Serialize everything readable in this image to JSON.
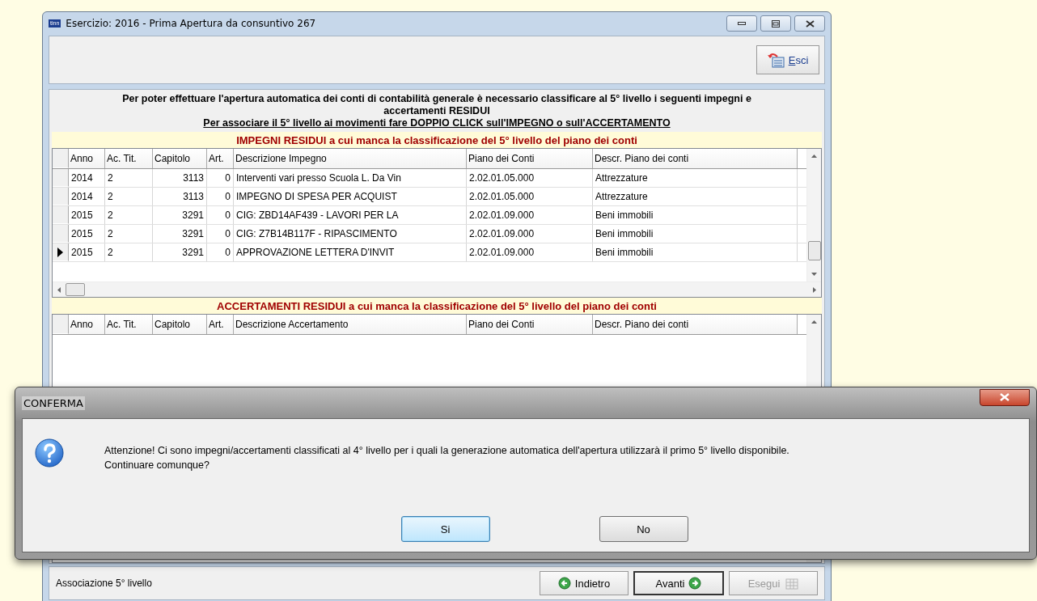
{
  "window": {
    "title": "Esercizio: 2016 - Prima Apertura da consuntivo 267",
    "app_icon": "tinn"
  },
  "toolbar": {
    "exit_button": {
      "label": "Esci"
    }
  },
  "instructions": {
    "line1": "Per poter effettuare l'apertura automatica dei conti di contabilità generale è necessario classificare al 5° livello i seguenti impegni e accertamenti RESIDUI",
    "line2": "Per associare il 5° livello ai movimenti fare DOPPIO CLICK sull'IMPEGNO o sull'ACCERTAMENTO"
  },
  "impegni": {
    "title": "IMPEGNI RESIDUI a cui manca la classificazione del 5° livello del piano dei conti",
    "columns": [
      "Anno",
      "Ac. Tit.",
      "Capitolo",
      "Art.",
      "Descrizione Impegno",
      "Piano dei Conti",
      "Descr. Piano dei conti"
    ],
    "rows": [
      {
        "selected": false,
        "cells": [
          "2014",
          "2",
          "3113",
          "0",
          "Interventi vari presso Scuola L. Da Vin",
          "2.02.01.05.000",
          "Attrezzature"
        ]
      },
      {
        "selected": false,
        "cells": [
          "2014",
          "2",
          "3113",
          "0",
          "IMPEGNO DI SPESA PER ACQUIST",
          "2.02.01.05.000",
          "Attrezzature"
        ]
      },
      {
        "selected": false,
        "cells": [
          "2015",
          "2",
          "3291",
          "0",
          "CIG: ZBD14AF439 - LAVORI PER LA",
          "2.02.01.09.000",
          "Beni immobili"
        ]
      },
      {
        "selected": false,
        "cells": [
          "2015",
          "2",
          "3291",
          "0",
          "CIG: Z7B14B117F - RIPASCIMENTO",
          "2.02.01.09.000",
          "Beni immobili"
        ]
      },
      {
        "selected": true,
        "cells": [
          "2015",
          "2",
          "3291",
          "0",
          "APPROVAZIONE LETTERA D'INVIT",
          "2.02.01.09.000",
          "Beni immobili"
        ]
      }
    ]
  },
  "accertamenti": {
    "title": "ACCERTAMENTI RESIDUI a cui manca la classificazione del 5° livello del piano dei conti",
    "columns": [
      "Anno",
      "Ac. Tit.",
      "Capitolo",
      "Art.",
      "Descrizione Accertamento",
      "Piano dei Conti",
      "Descr. Piano dei conti"
    ]
  },
  "status_bar": {
    "text": "Associazione 5° livello",
    "buttons": [
      {
        "label": "Indietro",
        "kind": "back",
        "disabled": false
      },
      {
        "label": "Avanti",
        "kind": "next",
        "disabled": false
      },
      {
        "label": "Esegui",
        "kind": "run",
        "disabled": true
      }
    ]
  },
  "dialog": {
    "title": "CONFERMA",
    "message": "Attenzione! Ci sono impegni/accertamenti classificati al 4° livello per i quali la generazione automatica dell'apertura utilizzarà il primo 5° livello disponibile.",
    "question": "Continuare comunque?",
    "buttons": [
      {
        "label": "Si",
        "focused": true
      },
      {
        "label": "No",
        "focused": false
      }
    ]
  }
}
